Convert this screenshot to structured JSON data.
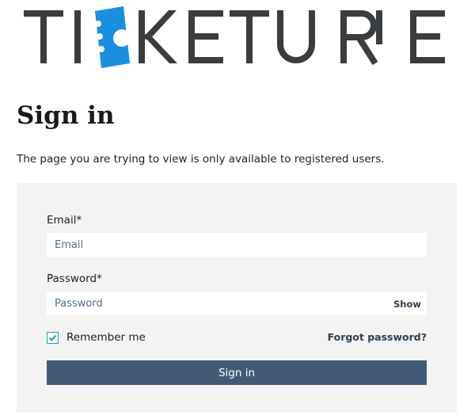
{
  "brand": {
    "logo_text": "TICKETURE",
    "text_color": "#3a3d40",
    "accent_color": "#1a8fe0"
  },
  "page": {
    "title": "Sign in",
    "intro": "The page you are trying to view is only available to registered users."
  },
  "form": {
    "email_label": "Email*",
    "email_placeholder": "Email",
    "email_value": "",
    "password_label": "Password*",
    "password_placeholder": "Password",
    "password_value": "",
    "show_label": "Show",
    "remember_label": "Remember me",
    "remember_checked": true,
    "forgot_label": "Forgot password?",
    "submit_label": "Sign in"
  },
  "colors": {
    "panel_bg": "#f3f3f3",
    "button_bg": "#435a77",
    "link": "#2f3e50",
    "checkbox": "#1aa0a8"
  }
}
